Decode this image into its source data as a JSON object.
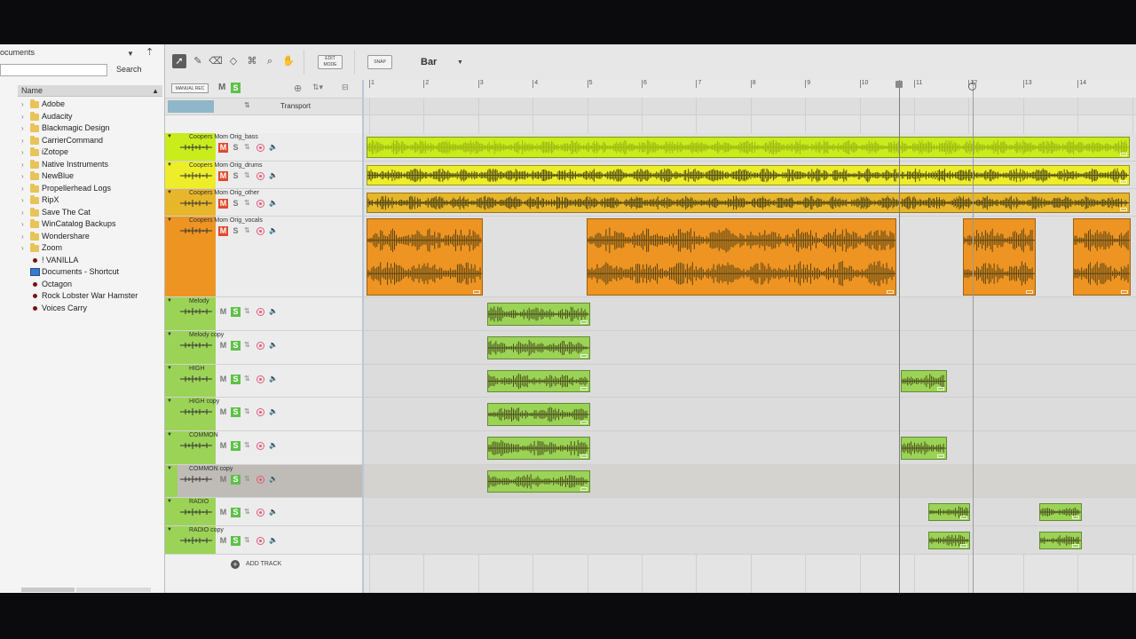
{
  "browser": {
    "location": "ocuments",
    "search_button": "Search",
    "search_value": "",
    "column_name": "Name",
    "folders": [
      "Adobe",
      "Audacity",
      "Blackmagic Design",
      "CarrierCommand",
      "iZotope",
      "Native Instruments",
      "NewBlue",
      "Propellerhead Logs",
      "RipX",
      "Save The Cat",
      "WinCatalog Backups",
      "Wondershare",
      "Zoom"
    ],
    "items": [
      {
        "label": "! VANILLA",
        "kind": "project"
      },
      {
        "label": "Documents - Shortcut",
        "kind": "shortcut"
      },
      {
        "label": "Octagon",
        "kind": "project"
      },
      {
        "label": "Rock Lobster War Hamster",
        "kind": "project"
      },
      {
        "label": "Voices Carry",
        "kind": "project"
      }
    ]
  },
  "toolbar": {
    "edit_mode": "EDIT MODE",
    "snap": "SNAP",
    "snap_value": "Bar",
    "tools": [
      "select-tool",
      "pencil-tool",
      "eraser-tool",
      "razor-tool",
      "mute-tool",
      "magnify-tool",
      "hand-tool"
    ]
  },
  "header": {
    "manual_rec": "MANUAL REC",
    "m": "M",
    "s": "S",
    "transport": "Transport",
    "add_track": "ADD TRACK"
  },
  "ruler": {
    "bars": [
      "1",
      "2",
      "3",
      "4",
      "5",
      "6",
      "7",
      "8",
      "9",
      "10",
      "11",
      "12",
      "13",
      "14"
    ]
  },
  "colors": {
    "lime": "#c9ec1c",
    "yellow": "#eded2a",
    "gold": "#e7b62a",
    "orange": "#ee9422",
    "green": "#9bd356",
    "mute_on": "#e04a2a",
    "solo_on": "#5fc04a"
  },
  "tracks": [
    {
      "name": "Coopers Mom Orig_bass",
      "color": "#c9ec1c",
      "m": "M",
      "s": "S",
      "mute": true,
      "solo": false
    },
    {
      "name": "Coopers Mom Orig_drums",
      "color": "#eded2a",
      "m": "M",
      "s": "S",
      "mute": true,
      "solo": false
    },
    {
      "name": "Coopers Mom Orig_other",
      "color": "#e7b62a",
      "m": "M",
      "s": "S",
      "mute": true,
      "solo": false
    },
    {
      "name": "Coopers Mom Orig_vocals",
      "color": "#ee9422",
      "m": "M",
      "s": "S",
      "mute": true,
      "solo": false
    },
    {
      "name": "Melody",
      "color": "#9bd356",
      "m": "M",
      "s": "S",
      "mute": false,
      "solo": true
    },
    {
      "name": "Melody copy",
      "color": "#9bd356",
      "m": "M",
      "s": "S",
      "mute": false,
      "solo": true
    },
    {
      "name": "HIGH",
      "color": "#9bd356",
      "m": "M",
      "s": "S",
      "mute": false,
      "solo": true
    },
    {
      "name": "HIGH copy",
      "color": "#9bd356",
      "m": "M",
      "s": "S",
      "mute": false,
      "solo": true
    },
    {
      "name": "COMMON",
      "color": "#9bd356",
      "m": "M",
      "s": "S",
      "mute": false,
      "solo": true
    },
    {
      "name": "COMMON copy",
      "color": "#9bd356",
      "m": "M",
      "s": "S",
      "mute": false,
      "solo": true,
      "selected": true
    },
    {
      "name": "RADIO",
      "color": "#9bd356",
      "m": "M",
      "s": "S",
      "mute": false,
      "solo": true
    },
    {
      "name": "RADIO copy",
      "color": "#9bd356",
      "m": "M",
      "s": "S",
      "mute": false,
      "solo": true
    }
  ]
}
